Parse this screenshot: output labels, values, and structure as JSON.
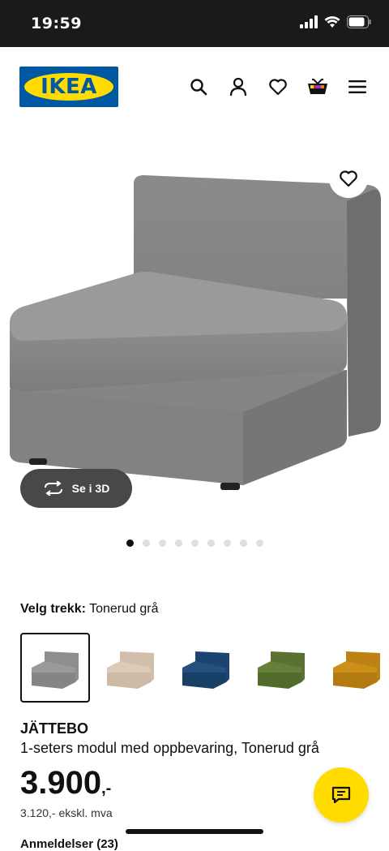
{
  "status_bar": {
    "time": "19:59"
  },
  "header": {
    "logo_text": "IKEA",
    "icons": [
      "search-icon",
      "profile-icon",
      "heart-icon",
      "cart-icon",
      "menu-icon"
    ]
  },
  "product_media": {
    "view_3d_label": "Se i 3D",
    "dots_total": 9,
    "dots_active": 1
  },
  "variant": {
    "label": "Velg trekk:",
    "value": "Tonerud grå",
    "swatches": [
      {
        "color": "#8e8e8e",
        "selected": true
      },
      {
        "color": "#d9c8b5",
        "selected": false
      },
      {
        "color": "#1f4e7a",
        "selected": false
      },
      {
        "color": "#627a36",
        "selected": false
      },
      {
        "color": "#c98c16",
        "selected": false
      }
    ]
  },
  "product": {
    "name": "JÄTTEBO",
    "description": "1-seters modul med oppbevaring, Tonerud grå",
    "price": "3.900",
    "price_suffix": ",-",
    "price_ex_vat": "3.120,- ekskl. mva",
    "reviews_partial": "Anmeldelser (23)"
  },
  "colors": {
    "ikea_blue": "#0058a3",
    "ikea_yellow": "#ffdb00"
  }
}
